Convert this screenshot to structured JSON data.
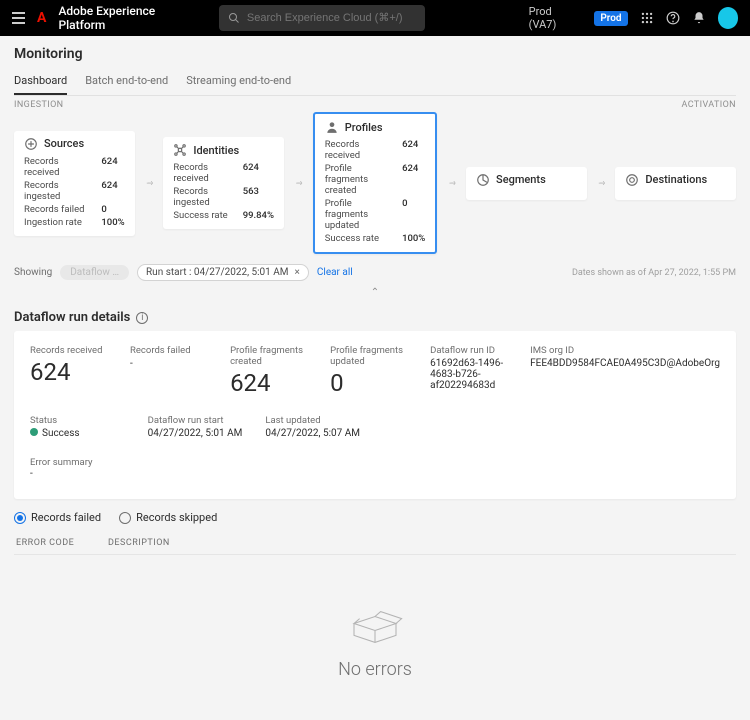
{
  "topbar": {
    "brand": "Adobe Experience Platform",
    "search_placeholder": "Search Experience Cloud (⌘+/)",
    "env_label": "Prod (VA7)",
    "env_badge": "Prod"
  },
  "page": {
    "title": "Monitoring",
    "tabs": [
      "Dashboard",
      "Batch end-to-end",
      "Streaming end-to-end"
    ],
    "active_tab": 0
  },
  "meta": {
    "left": "INGESTION",
    "right": "ACTIVATION"
  },
  "cards": {
    "sources": {
      "title": "Sources",
      "items": [
        {
          "label": "Records received",
          "value": "624"
        },
        {
          "label": "Records ingested",
          "value": "624"
        },
        {
          "label": "Records failed",
          "value": "0"
        },
        {
          "label": "Ingestion rate",
          "value": "100%"
        }
      ]
    },
    "identities": {
      "title": "Identities",
      "items": [
        {
          "label": "Records received",
          "value": "624"
        },
        {
          "label": "Records ingested",
          "value": "563"
        },
        {
          "label": "Success rate",
          "value": "99.84%"
        }
      ]
    },
    "profiles": {
      "title": "Profiles",
      "items": [
        {
          "label": "Records received",
          "value": "624"
        },
        {
          "label": "Profile fragments created",
          "value": "624"
        },
        {
          "label": "Profile fragments updated",
          "value": "0"
        },
        {
          "label": "Success rate",
          "value": "100%"
        }
      ]
    },
    "segments": {
      "title": "Segments"
    },
    "destinations": {
      "title": "Destinations"
    }
  },
  "filters": {
    "showing": "Showing",
    "dataflow_faded": "Dataflow …",
    "run_chip": "Run start : 04/27/2022, 5:01 AM",
    "clear_all": "Clear all",
    "timestamp": "Dates shown as of Apr 27, 2022, 1:55 PM"
  },
  "details": {
    "heading": "Dataflow run details",
    "metrics": {
      "records_received": {
        "label": "Records received",
        "value": "624"
      },
      "records_failed": {
        "label": "Records failed",
        "value": "-"
      },
      "pf_created": {
        "label": "Profile fragments created",
        "value": "624"
      },
      "pf_updated": {
        "label": "Profile fragments updated",
        "value": "0"
      },
      "run_id": {
        "label": "Dataflow run ID",
        "value": "61692d63-1496-4683-b726-af202294683d"
      },
      "org_id": {
        "label": "IMS org ID",
        "value": "FEE4BDD9584FCAE0A495C3D@AdobeOrg"
      }
    },
    "sub": {
      "status": {
        "label": "Status",
        "value": "Success"
      },
      "run_start": {
        "label": "Dataflow run start",
        "value": "04/27/2022, 5:01 AM"
      },
      "last_updated": {
        "label": "Last updated",
        "value": "04/27/2022, 5:07 AM"
      }
    },
    "error_summary": {
      "label": "Error summary",
      "value": "-"
    }
  },
  "radios": {
    "failed": "Records failed",
    "skipped": "Records skipped"
  },
  "table": {
    "col1": "ERROR CODE",
    "col2": "DESCRIPTION"
  },
  "empty": {
    "text": "No errors"
  }
}
